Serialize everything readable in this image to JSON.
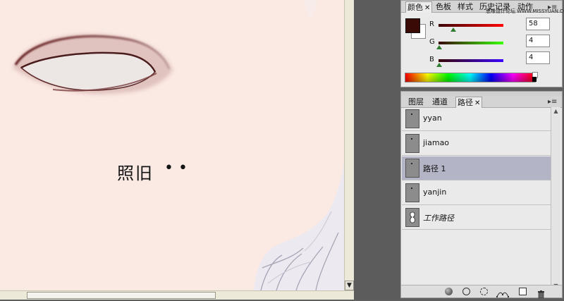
{
  "canvas": {
    "caption": "照旧",
    "dots": "• •"
  },
  "color_panel": {
    "tabs": [
      {
        "label": "颜色",
        "active": true
      },
      {
        "label": "色板",
        "active": false
      },
      {
        "label": "样式",
        "active": false
      },
      {
        "label": "历史记录",
        "active": false
      },
      {
        "label": "动作",
        "active": false
      }
    ],
    "watermark": "思缘设计论坛 WWW.MISSYUAN.COM",
    "foreground_color": "#3a0a06",
    "sliders": [
      {
        "label": "R",
        "value": "58",
        "fraction": 0.227
      },
      {
        "label": "G",
        "value": "4",
        "fraction": 0.016
      },
      {
        "label": "B",
        "value": "4",
        "fraction": 0.016
      }
    ]
  },
  "paths_panel": {
    "tabs": [
      {
        "label": "图层",
        "active": false
      },
      {
        "label": "通道",
        "active": false
      },
      {
        "label": "路径",
        "active": true
      }
    ],
    "items": [
      {
        "label": "yyan",
        "selected": false,
        "italic": false
      },
      {
        "label": "jiamao",
        "selected": false,
        "italic": false
      },
      {
        "label": "路径 1",
        "selected": true,
        "italic": false
      },
      {
        "label": "yanjin",
        "selected": false,
        "italic": false
      },
      {
        "label": "工作路径",
        "selected": false,
        "italic": true
      }
    ],
    "footer_icons": [
      "fill-path-icon",
      "stroke-path-icon",
      "load-selection-icon",
      "make-work-path-icon",
      "new-path-icon",
      "delete-path-icon"
    ]
  },
  "scrollbar": {
    "down_arrow": "▼"
  },
  "colors": {
    "canvas_bg": "#fbe9e3",
    "workspace": "#5f5f5f",
    "selected_row": "#b3b5c6"
  }
}
